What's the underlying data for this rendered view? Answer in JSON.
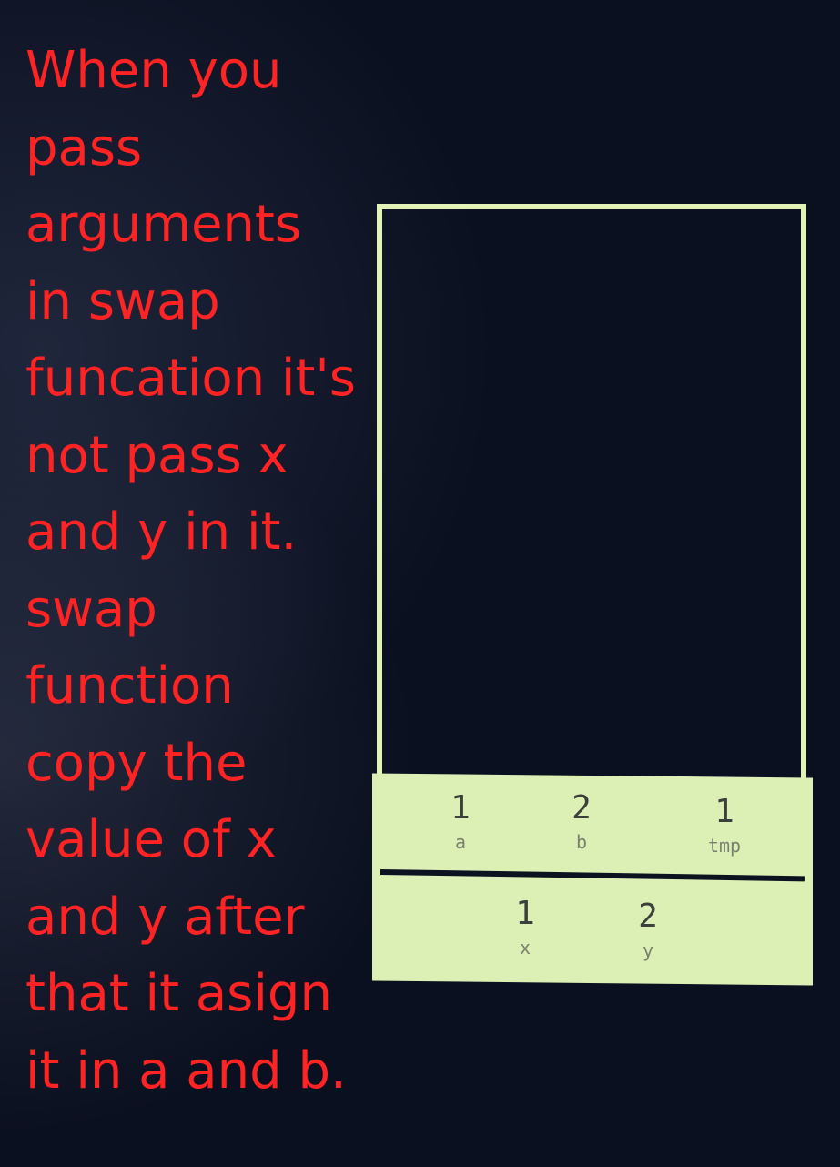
{
  "caption": {
    "lines": [
      "When you",
      "pass",
      "arguments",
      "in swap",
      "funcation it's",
      "not pass x",
      "and y in it.",
      "swap",
      "function",
      "copy the",
      "value of x",
      "and y after",
      "that it asign",
      "it in a and b."
    ]
  },
  "stack": {
    "swap_frame": [
      {
        "value": "1",
        "name": "a"
      },
      {
        "value": "2",
        "name": "b"
      },
      {
        "value": "1",
        "name": "tmp"
      }
    ],
    "main_frame": [
      {
        "value": "1",
        "name": "x"
      },
      {
        "value": "2",
        "name": "y"
      }
    ]
  },
  "colors": {
    "background": "#0b1020",
    "caption_text": "#ff2323",
    "panel": "#dcefb4",
    "frame_border": "#e3f3b8"
  }
}
